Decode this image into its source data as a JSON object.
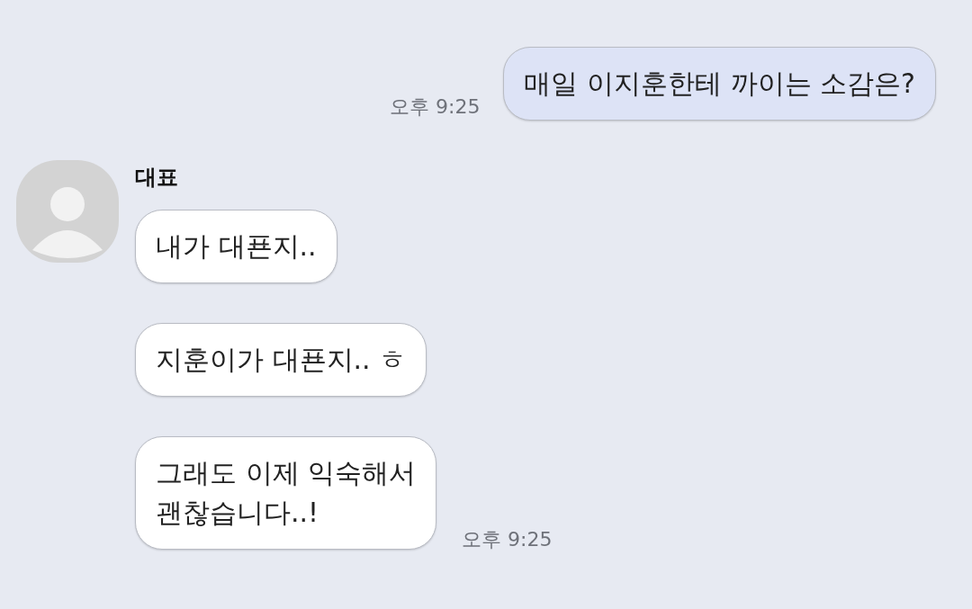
{
  "sent": [
    {
      "text": "매일 이지훈한테 까이는 소감은?",
      "time": "오후 9:25"
    }
  ],
  "received": {
    "sender": "대표",
    "messages": [
      {
        "text": "내가 대푠지.."
      },
      {
        "text": "지훈이가 대푠지.. ㅎ"
      },
      {
        "text": "그래도 이제 익숙해서\n괜찮습니다..!",
        "time": "오후 9:25"
      }
    ]
  }
}
